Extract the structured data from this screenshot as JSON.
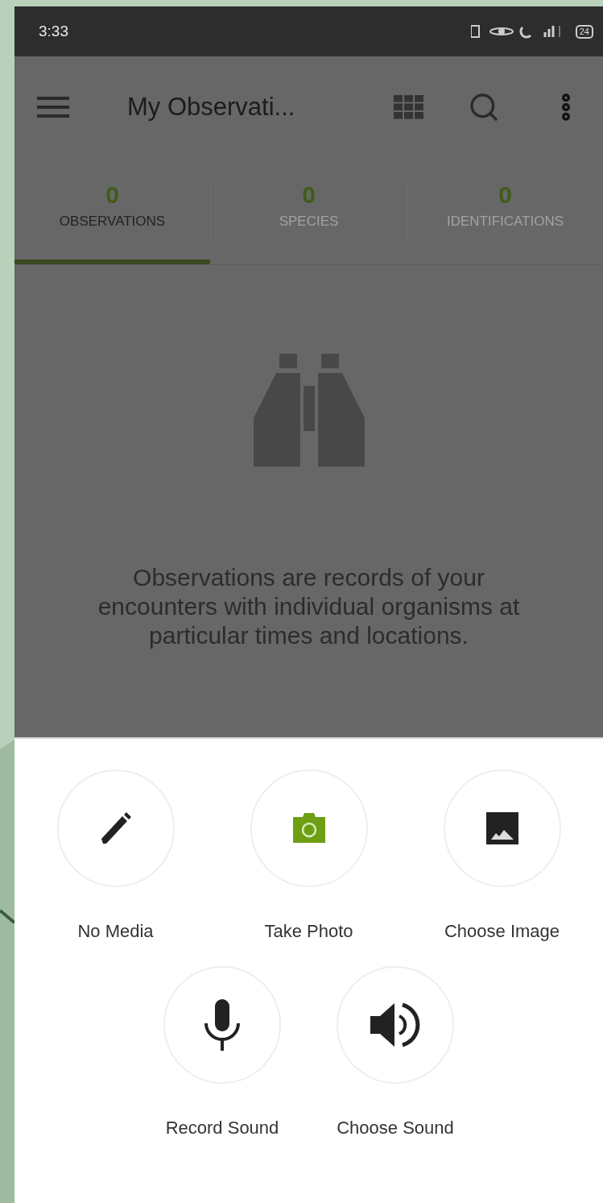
{
  "status_bar": {
    "time": "3:33",
    "battery": "24"
  },
  "app_bar": {
    "title": "My Observati..."
  },
  "tabs": [
    {
      "count": "0",
      "label": "OBSERVATIONS",
      "selected": true
    },
    {
      "count": "0",
      "label": "SPECIES",
      "selected": false
    },
    {
      "count": "0",
      "label": "IDENTIFICATIONS",
      "selected": false
    }
  ],
  "empty_state": {
    "message": "Observations are records of your encounters with individual organisms at particular times and locations."
  },
  "media_sheet": {
    "rows": [
      [
        {
          "kind": "pencil",
          "label": "No Media"
        },
        {
          "kind": "camera",
          "label": "Take Photo"
        },
        {
          "kind": "image",
          "label": "Choose Image"
        }
      ],
      [
        {
          "kind": "mic",
          "label": "Record Sound"
        },
        {
          "kind": "speaker",
          "label": "Choose Sound"
        }
      ]
    ]
  }
}
